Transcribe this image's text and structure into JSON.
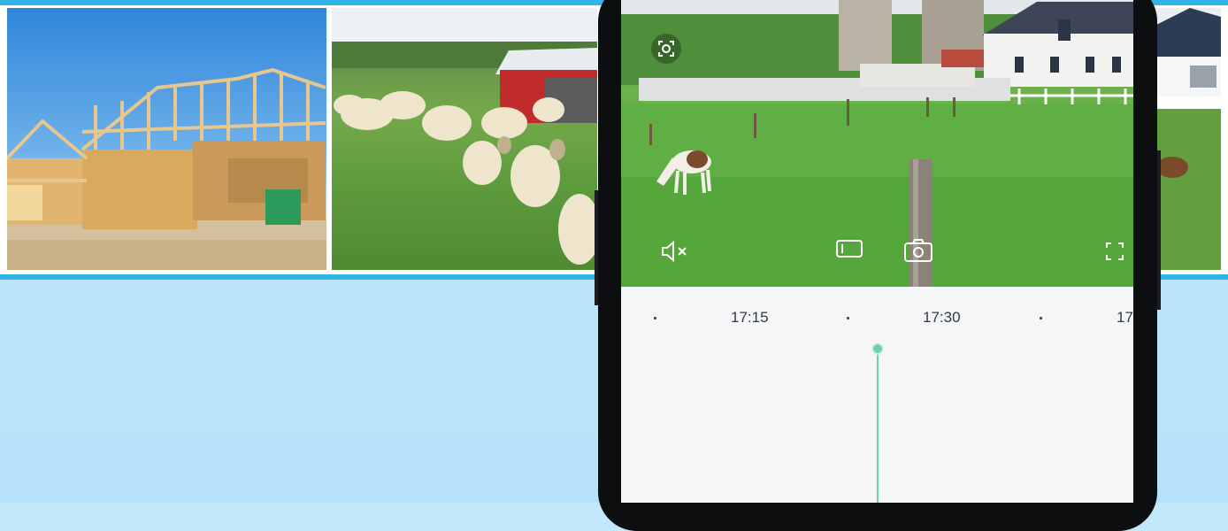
{
  "timeline": {
    "ticks": [
      "17:15",
      "17:30",
      "17"
    ]
  },
  "video_controls": {
    "icons": [
      "focus-icon",
      "mute-icon",
      "record-icon",
      "camera-icon",
      "fullscreen-icon"
    ]
  },
  "colors": {
    "accent_blue": "#31b4e8",
    "background_blue": "#c3e7fb",
    "timeline_cursor": "#6fcfb2",
    "phone_frame": "#0d0e10"
  }
}
